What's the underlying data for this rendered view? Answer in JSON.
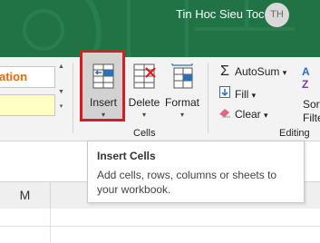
{
  "account": {
    "name": "Tin Hoc Sieu Toc",
    "initials": "TH"
  },
  "styles": {
    "cell_style_label": "ation"
  },
  "cells_group": {
    "label": "Cells",
    "insert": {
      "label": "Insert",
      "arrow": "▾"
    },
    "delete": {
      "label": "Delete",
      "arrow": "▾"
    },
    "format": {
      "label": "Format",
      "arrow": "▾"
    }
  },
  "editing_group": {
    "label": "Editing",
    "autosum": {
      "label": "AutoSum",
      "arrow": "▾",
      "icon": "Σ"
    },
    "fill": {
      "label": "Fill",
      "arrow": "▾"
    },
    "clear": {
      "label": "Clear",
      "arrow": "▾"
    },
    "sort": {
      "line1": "Sort",
      "line2": "Filte"
    }
  },
  "tooltip": {
    "title": "Insert Cells",
    "body": "Add cells, rows, columns or sheets to your workbook."
  },
  "sheet": {
    "column_m": "M"
  },
  "colors": {
    "titlebar": "#217346",
    "highlight": "#e0191f",
    "accent_orange": "#e36c09"
  }
}
